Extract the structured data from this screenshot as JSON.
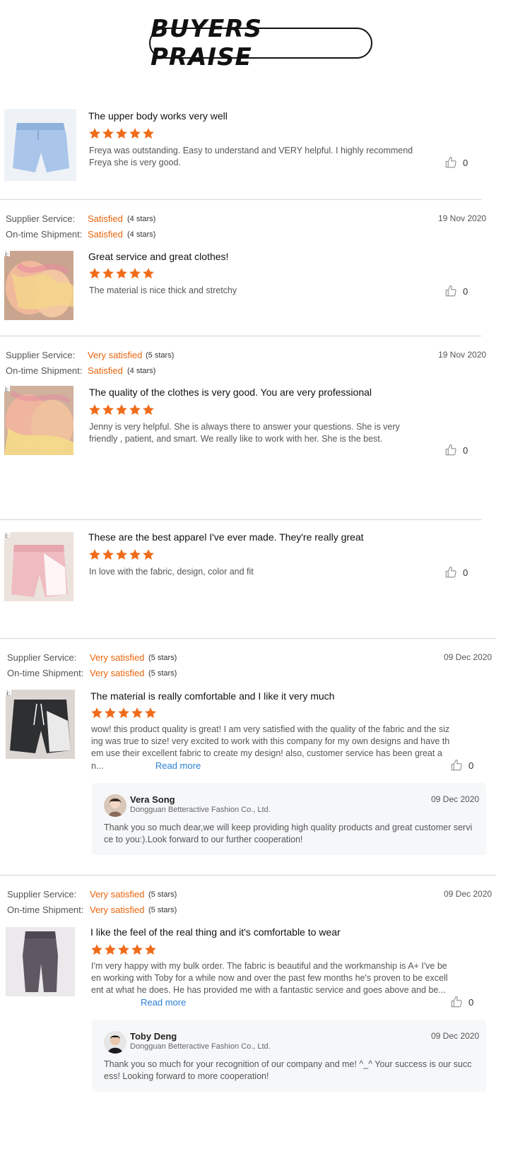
{
  "header": {
    "title": "BUYERS PRAISE"
  },
  "labels": {
    "supplier_service": "Supplier Service:",
    "on_time_shipment": "On-time Shipment:"
  },
  "colors": {
    "accent": "#e8640c",
    "star": "#f06c1a",
    "link": "#2a7fd4"
  },
  "reviews": [
    {
      "title": "The upper body works very well",
      "rating": 5,
      "body": "Freya was outstanding. Easy to understand and VERY helpful. I highly recommend Freya she is very good.",
      "likes": "0"
    },
    {
      "supplier_service": {
        "value": "Satisfied",
        "stars": "(4 stars)"
      },
      "on_time_shipment": {
        "value": "Satisfied",
        "stars": "(4 stars)"
      },
      "date": "19 Nov 2020",
      "title": "Great service and great clothes!",
      "rating": 5,
      "body": "The material is nice thick and stretchy",
      "likes": "0"
    },
    {
      "supplier_service": {
        "value": "Very satisfied",
        "stars": "(5 stars)"
      },
      "on_time_shipment": {
        "value": "Satisfied",
        "stars": "(4 stars)"
      },
      "date": "19 Nov 2020",
      "title": "The quality of the clothes is very good. You are very professional",
      "rating": 5,
      "body": "Jenny is very helpful. She is always there to answer your questions. She is  very friendly , patient, and smart. We really like to work with her. She is the best.",
      "likes": "0"
    },
    {
      "title": "These are the best  apparel  I've ever made. They're really great",
      "rating": 5,
      "body": "In love with the fabric, design,  color and fit",
      "likes": "0"
    },
    {
      "supplier_service": {
        "value": "Very satisfied",
        "stars": "(5 stars)"
      },
      "on_time_shipment": {
        "value": "Very satisfied",
        "stars": "(5 stars)"
      },
      "date": "09 Dec 2020",
      "title": "The material is really comfortable and I like it very much",
      "rating": 5,
      "body": "wow! this product quality is great! I am very satisfied with the quality of the fabric and the sizing was true to size! very excited to work with this company for my own designs and have them use their excellent fabric to create my design! also, customer service has been great a n...",
      "read_more": "Read more",
      "likes": "0",
      "reply": {
        "name": "Vera Song",
        "company": "Dongguan Betteractive Fashion Co., Ltd.",
        "date": "09 Dec 2020",
        "text": "Thank you so much dear,we will keep providing high quality products and great customer service to you:).Look forward to our further cooperation!"
      }
    },
    {
      "supplier_service": {
        "value": "Very satisfied",
        "stars": "(5 stars)"
      },
      "on_time_shipment": {
        "value": "Very satisfied",
        "stars": "(5 stars)"
      },
      "date": "09 Dec 2020",
      "title": "I like the feel of the real thing and it's comfortable to wear",
      "rating": 5,
      "body": "I'm very happy with my bulk order. The fabric is beautiful and the workmanship is A+ I've been working with Toby for a while now and over the past few months he's proven to be excellent at what he does. He has provided me with a fantastic service and goes above and be...",
      "read_more": "Read more",
      "likes": "0",
      "reply": {
        "name": "Toby Deng",
        "company": "Dongguan Betteractive Fashion Co., Ltd.",
        "date": "09 Dec 2020",
        "text": "Thank you so much for your recognition of our company and me!  ^_^ Your success is our success! Looking forward to more cooperation!"
      }
    }
  ],
  "icons": {
    "like": "thumbs-up-icon",
    "star": "star-icon"
  }
}
